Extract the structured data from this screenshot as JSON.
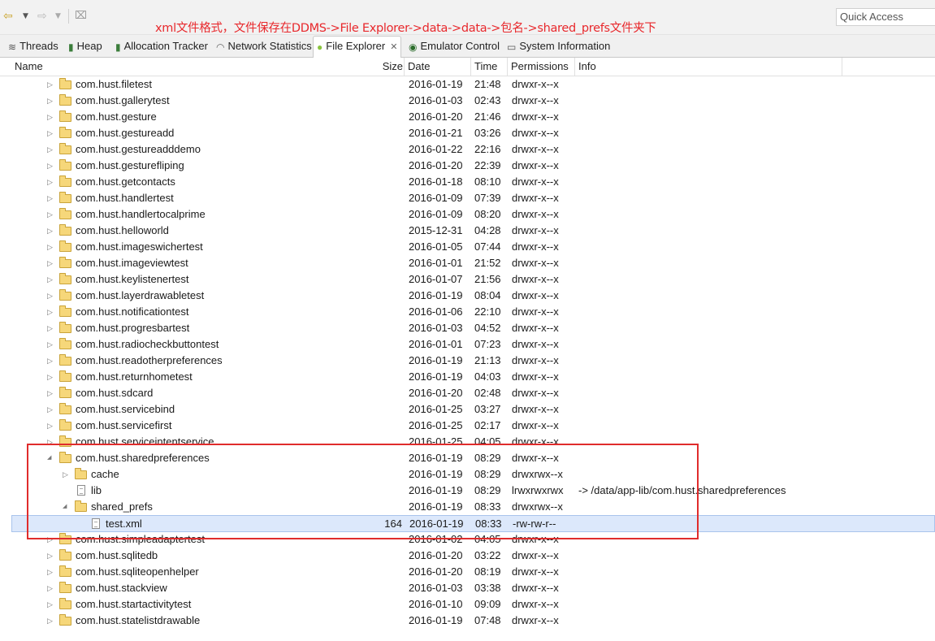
{
  "toolbar": {
    "quick_access_placeholder": "Quick Access",
    "back_icon": "arrow-left-icon",
    "forward_icon": "arrow-right-icon"
  },
  "annotation": {
    "text": "xml文件格式，文件保存在DDMS->File Explorer->data->data->包名->shared_prefs文件夹下",
    "color": "#e8282c"
  },
  "tabs": [
    {
      "label": "Threads",
      "icon": "threads-icon"
    },
    {
      "label": "Heap",
      "icon": "heap-icon"
    },
    {
      "label": "Allocation Tracker",
      "icon": "allocation-icon"
    },
    {
      "label": "Network Statistics",
      "icon": "wifi-icon"
    },
    {
      "label": "File Explorer",
      "icon": "android-icon",
      "active": true
    },
    {
      "label": "Emulator Control",
      "icon": "phone-icon"
    },
    {
      "label": "System Information",
      "icon": "window-icon"
    }
  ],
  "columns": {
    "name": "Name",
    "size": "Size",
    "date": "Date",
    "time": "Time",
    "permissions": "Permissions",
    "info": "Info"
  },
  "rows": [
    {
      "name": "com.hust.filetest",
      "size": "",
      "date": "2016-01-19",
      "time": "21:48",
      "perm": "drwxr-x--x",
      "info": "",
      "type": "folder",
      "level": 0,
      "expanded": false
    },
    {
      "name": "com.hust.gallerytest",
      "size": "",
      "date": "2016-01-03",
      "time": "02:43",
      "perm": "drwxr-x--x",
      "info": "",
      "type": "folder",
      "level": 0,
      "expanded": false
    },
    {
      "name": "com.hust.gesture",
      "size": "",
      "date": "2016-01-20",
      "time": "21:46",
      "perm": "drwxr-x--x",
      "info": "",
      "type": "folder",
      "level": 0,
      "expanded": false
    },
    {
      "name": "com.hust.gestureadd",
      "size": "",
      "date": "2016-01-21",
      "time": "03:26",
      "perm": "drwxr-x--x",
      "info": "",
      "type": "folder",
      "level": 0,
      "expanded": false
    },
    {
      "name": "com.hust.gestureadddemo",
      "size": "",
      "date": "2016-01-22",
      "time": "22:16",
      "perm": "drwxr-x--x",
      "info": "",
      "type": "folder",
      "level": 0,
      "expanded": false
    },
    {
      "name": "com.hust.gesturefliping",
      "size": "",
      "date": "2016-01-20",
      "time": "22:39",
      "perm": "drwxr-x--x",
      "info": "",
      "type": "folder",
      "level": 0,
      "expanded": false
    },
    {
      "name": "com.hust.getcontacts",
      "size": "",
      "date": "2016-01-18",
      "time": "08:10",
      "perm": "drwxr-x--x",
      "info": "",
      "type": "folder",
      "level": 0,
      "expanded": false
    },
    {
      "name": "com.hust.handlertest",
      "size": "",
      "date": "2016-01-09",
      "time": "07:39",
      "perm": "drwxr-x--x",
      "info": "",
      "type": "folder",
      "level": 0,
      "expanded": false
    },
    {
      "name": "com.hust.handlertocalprime",
      "size": "",
      "date": "2016-01-09",
      "time": "08:20",
      "perm": "drwxr-x--x",
      "info": "",
      "type": "folder",
      "level": 0,
      "expanded": false
    },
    {
      "name": "com.hust.helloworld",
      "size": "",
      "date": "2015-12-31",
      "time": "04:28",
      "perm": "drwxr-x--x",
      "info": "",
      "type": "folder",
      "level": 0,
      "expanded": false
    },
    {
      "name": "com.hust.imageswichertest",
      "size": "",
      "date": "2016-01-05",
      "time": "07:44",
      "perm": "drwxr-x--x",
      "info": "",
      "type": "folder",
      "level": 0,
      "expanded": false
    },
    {
      "name": "com.hust.imageviewtest",
      "size": "",
      "date": "2016-01-01",
      "time": "21:52",
      "perm": "drwxr-x--x",
      "info": "",
      "type": "folder",
      "level": 0,
      "expanded": false
    },
    {
      "name": "com.hust.keylistenertest",
      "size": "",
      "date": "2016-01-07",
      "time": "21:56",
      "perm": "drwxr-x--x",
      "info": "",
      "type": "folder",
      "level": 0,
      "expanded": false
    },
    {
      "name": "com.hust.layerdrawabletest",
      "size": "",
      "date": "2016-01-19",
      "time": "08:04",
      "perm": "drwxr-x--x",
      "info": "",
      "type": "folder",
      "level": 0,
      "expanded": false
    },
    {
      "name": "com.hust.notificationtest",
      "size": "",
      "date": "2016-01-06",
      "time": "22:10",
      "perm": "drwxr-x--x",
      "info": "",
      "type": "folder",
      "level": 0,
      "expanded": false
    },
    {
      "name": "com.hust.progresbartest",
      "size": "",
      "date": "2016-01-03",
      "time": "04:52",
      "perm": "drwxr-x--x",
      "info": "",
      "type": "folder",
      "level": 0,
      "expanded": false
    },
    {
      "name": "com.hust.radiocheckbuttontest",
      "size": "",
      "date": "2016-01-01",
      "time": "07:23",
      "perm": "drwxr-x--x",
      "info": "",
      "type": "folder",
      "level": 0,
      "expanded": false
    },
    {
      "name": "com.hust.readotherpreferences",
      "size": "",
      "date": "2016-01-19",
      "time": "21:13",
      "perm": "drwxr-x--x",
      "info": "",
      "type": "folder",
      "level": 0,
      "expanded": false
    },
    {
      "name": "com.hust.returnhometest",
      "size": "",
      "date": "2016-01-19",
      "time": "04:03",
      "perm": "drwxr-x--x",
      "info": "",
      "type": "folder",
      "level": 0,
      "expanded": false
    },
    {
      "name": "com.hust.sdcard",
      "size": "",
      "date": "2016-01-20",
      "time": "02:48",
      "perm": "drwxr-x--x",
      "info": "",
      "type": "folder",
      "level": 0,
      "expanded": false
    },
    {
      "name": "com.hust.servicebind",
      "size": "",
      "date": "2016-01-25",
      "time": "03:27",
      "perm": "drwxr-x--x",
      "info": "",
      "type": "folder",
      "level": 0,
      "expanded": false
    },
    {
      "name": "com.hust.servicefirst",
      "size": "",
      "date": "2016-01-25",
      "time": "02:17",
      "perm": "drwxr-x--x",
      "info": "",
      "type": "folder",
      "level": 0,
      "expanded": false
    },
    {
      "name": "com.hust.serviceintentservice",
      "size": "",
      "date": "2016-01-25",
      "time": "04:05",
      "perm": "drwxr-x--x",
      "info": "",
      "type": "folder",
      "level": 0,
      "expanded": false
    },
    {
      "name": "com.hust.sharedpreferences",
      "size": "",
      "date": "2016-01-19",
      "time": "08:29",
      "perm": "drwxr-x--x",
      "info": "",
      "type": "folder",
      "level": 0,
      "expanded": true
    },
    {
      "name": "cache",
      "size": "",
      "date": "2016-01-19",
      "time": "08:29",
      "perm": "drwxrwx--x",
      "info": "",
      "type": "folder",
      "level": 1,
      "expanded": false
    },
    {
      "name": "lib",
      "size": "",
      "date": "2016-01-19",
      "time": "08:29",
      "perm": "lrwxrwxrwx",
      "info": "-> /data/app-lib/com.hust.sharedpreferences",
      "type": "file",
      "level": 1
    },
    {
      "name": "shared_prefs",
      "size": "",
      "date": "2016-01-19",
      "time": "08:33",
      "perm": "drwxrwx--x",
      "info": "",
      "type": "folder",
      "level": 1,
      "expanded": true
    },
    {
      "name": "test.xml",
      "size": "164",
      "date": "2016-01-19",
      "time": "08:33",
      "perm": "-rw-rw-r--",
      "info": "",
      "type": "file",
      "level": 2,
      "selected": true
    },
    {
      "name": "com.hust.simpleadaptertest",
      "size": "",
      "date": "2016-01-02",
      "time": "04:05",
      "perm": "drwxr-x--x",
      "info": "",
      "type": "folder",
      "level": 0,
      "expanded": false
    },
    {
      "name": "com.hust.sqlitedb",
      "size": "",
      "date": "2016-01-20",
      "time": "03:22",
      "perm": "drwxr-x--x",
      "info": "",
      "type": "folder",
      "level": 0,
      "expanded": false
    },
    {
      "name": "com.hust.sqliteopenhelper",
      "size": "",
      "date": "2016-01-20",
      "time": "08:19",
      "perm": "drwxr-x--x",
      "info": "",
      "type": "folder",
      "level": 0,
      "expanded": false
    },
    {
      "name": "com.hust.stackview",
      "size": "",
      "date": "2016-01-03",
      "time": "03:38",
      "perm": "drwxr-x--x",
      "info": "",
      "type": "folder",
      "level": 0,
      "expanded": false
    },
    {
      "name": "com.hust.startactivitytest",
      "size": "",
      "date": "2016-01-10",
      "time": "09:09",
      "perm": "drwxr-x--x",
      "info": "",
      "type": "folder",
      "level": 0,
      "expanded": false
    },
    {
      "name": "com.hust.statelistdrawable",
      "size": "",
      "date": "2016-01-19",
      "time": "07:48",
      "perm": "drwxr-x--x",
      "info": "",
      "type": "folder",
      "level": 0,
      "expanded": false
    }
  ],
  "colors": {
    "highlight_box": "#e02c2c",
    "selection": "#dce8fb",
    "folder": "#f6d77a"
  }
}
